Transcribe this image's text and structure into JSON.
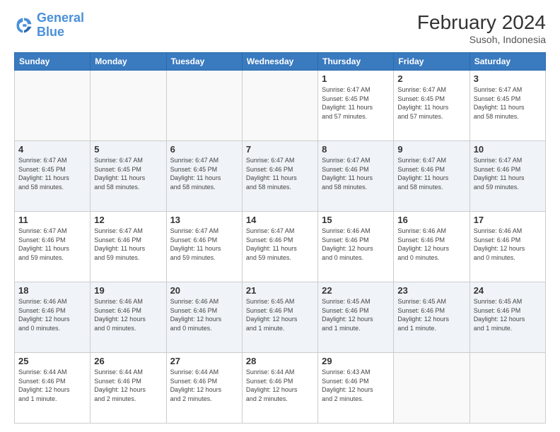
{
  "header": {
    "logo_line1": "General",
    "logo_line2": "Blue",
    "month_year": "February 2024",
    "location": "Susoh, Indonesia"
  },
  "days_of_week": [
    "Sunday",
    "Monday",
    "Tuesday",
    "Wednesday",
    "Thursday",
    "Friday",
    "Saturday"
  ],
  "weeks": [
    [
      {
        "day": "",
        "info": []
      },
      {
        "day": "",
        "info": []
      },
      {
        "day": "",
        "info": []
      },
      {
        "day": "",
        "info": []
      },
      {
        "day": "1",
        "info": [
          "Sunrise: 6:47 AM",
          "Sunset: 6:45 PM",
          "Daylight: 11 hours",
          "and 57 minutes."
        ]
      },
      {
        "day": "2",
        "info": [
          "Sunrise: 6:47 AM",
          "Sunset: 6:45 PM",
          "Daylight: 11 hours",
          "and 57 minutes."
        ]
      },
      {
        "day": "3",
        "info": [
          "Sunrise: 6:47 AM",
          "Sunset: 6:45 PM",
          "Daylight: 11 hours",
          "and 58 minutes."
        ]
      }
    ],
    [
      {
        "day": "4",
        "info": [
          "Sunrise: 6:47 AM",
          "Sunset: 6:45 PM",
          "Daylight: 11 hours",
          "and 58 minutes."
        ]
      },
      {
        "day": "5",
        "info": [
          "Sunrise: 6:47 AM",
          "Sunset: 6:45 PM",
          "Daylight: 11 hours",
          "and 58 minutes."
        ]
      },
      {
        "day": "6",
        "info": [
          "Sunrise: 6:47 AM",
          "Sunset: 6:45 PM",
          "Daylight: 11 hours",
          "and 58 minutes."
        ]
      },
      {
        "day": "7",
        "info": [
          "Sunrise: 6:47 AM",
          "Sunset: 6:46 PM",
          "Daylight: 11 hours",
          "and 58 minutes."
        ]
      },
      {
        "day": "8",
        "info": [
          "Sunrise: 6:47 AM",
          "Sunset: 6:46 PM",
          "Daylight: 11 hours",
          "and 58 minutes."
        ]
      },
      {
        "day": "9",
        "info": [
          "Sunrise: 6:47 AM",
          "Sunset: 6:46 PM",
          "Daylight: 11 hours",
          "and 58 minutes."
        ]
      },
      {
        "day": "10",
        "info": [
          "Sunrise: 6:47 AM",
          "Sunset: 6:46 PM",
          "Daylight: 11 hours",
          "and 59 minutes."
        ]
      }
    ],
    [
      {
        "day": "11",
        "info": [
          "Sunrise: 6:47 AM",
          "Sunset: 6:46 PM",
          "Daylight: 11 hours",
          "and 59 minutes."
        ]
      },
      {
        "day": "12",
        "info": [
          "Sunrise: 6:47 AM",
          "Sunset: 6:46 PM",
          "Daylight: 11 hours",
          "and 59 minutes."
        ]
      },
      {
        "day": "13",
        "info": [
          "Sunrise: 6:47 AM",
          "Sunset: 6:46 PM",
          "Daylight: 11 hours",
          "and 59 minutes."
        ]
      },
      {
        "day": "14",
        "info": [
          "Sunrise: 6:47 AM",
          "Sunset: 6:46 PM",
          "Daylight: 11 hours",
          "and 59 minutes."
        ]
      },
      {
        "day": "15",
        "info": [
          "Sunrise: 6:46 AM",
          "Sunset: 6:46 PM",
          "Daylight: 12 hours",
          "and 0 minutes."
        ]
      },
      {
        "day": "16",
        "info": [
          "Sunrise: 6:46 AM",
          "Sunset: 6:46 PM",
          "Daylight: 12 hours",
          "and 0 minutes."
        ]
      },
      {
        "day": "17",
        "info": [
          "Sunrise: 6:46 AM",
          "Sunset: 6:46 PM",
          "Daylight: 12 hours",
          "and 0 minutes."
        ]
      }
    ],
    [
      {
        "day": "18",
        "info": [
          "Sunrise: 6:46 AM",
          "Sunset: 6:46 PM",
          "Daylight: 12 hours",
          "and 0 minutes."
        ]
      },
      {
        "day": "19",
        "info": [
          "Sunrise: 6:46 AM",
          "Sunset: 6:46 PM",
          "Daylight: 12 hours",
          "and 0 minutes."
        ]
      },
      {
        "day": "20",
        "info": [
          "Sunrise: 6:46 AM",
          "Sunset: 6:46 PM",
          "Daylight: 12 hours",
          "and 0 minutes."
        ]
      },
      {
        "day": "21",
        "info": [
          "Sunrise: 6:45 AM",
          "Sunset: 6:46 PM",
          "Daylight: 12 hours",
          "and 1 minute."
        ]
      },
      {
        "day": "22",
        "info": [
          "Sunrise: 6:45 AM",
          "Sunset: 6:46 PM",
          "Daylight: 12 hours",
          "and 1 minute."
        ]
      },
      {
        "day": "23",
        "info": [
          "Sunrise: 6:45 AM",
          "Sunset: 6:46 PM",
          "Daylight: 12 hours",
          "and 1 minute."
        ]
      },
      {
        "day": "24",
        "info": [
          "Sunrise: 6:45 AM",
          "Sunset: 6:46 PM",
          "Daylight: 12 hours",
          "and 1 minute."
        ]
      }
    ],
    [
      {
        "day": "25",
        "info": [
          "Sunrise: 6:44 AM",
          "Sunset: 6:46 PM",
          "Daylight: 12 hours",
          "and 1 minute."
        ]
      },
      {
        "day": "26",
        "info": [
          "Sunrise: 6:44 AM",
          "Sunset: 6:46 PM",
          "Daylight: 12 hours",
          "and 2 minutes."
        ]
      },
      {
        "day": "27",
        "info": [
          "Sunrise: 6:44 AM",
          "Sunset: 6:46 PM",
          "Daylight: 12 hours",
          "and 2 minutes."
        ]
      },
      {
        "day": "28",
        "info": [
          "Sunrise: 6:44 AM",
          "Sunset: 6:46 PM",
          "Daylight: 12 hours",
          "and 2 minutes."
        ]
      },
      {
        "day": "29",
        "info": [
          "Sunrise: 6:43 AM",
          "Sunset: 6:46 PM",
          "Daylight: 12 hours",
          "and 2 minutes."
        ]
      },
      {
        "day": "",
        "info": []
      },
      {
        "day": "",
        "info": []
      }
    ]
  ]
}
